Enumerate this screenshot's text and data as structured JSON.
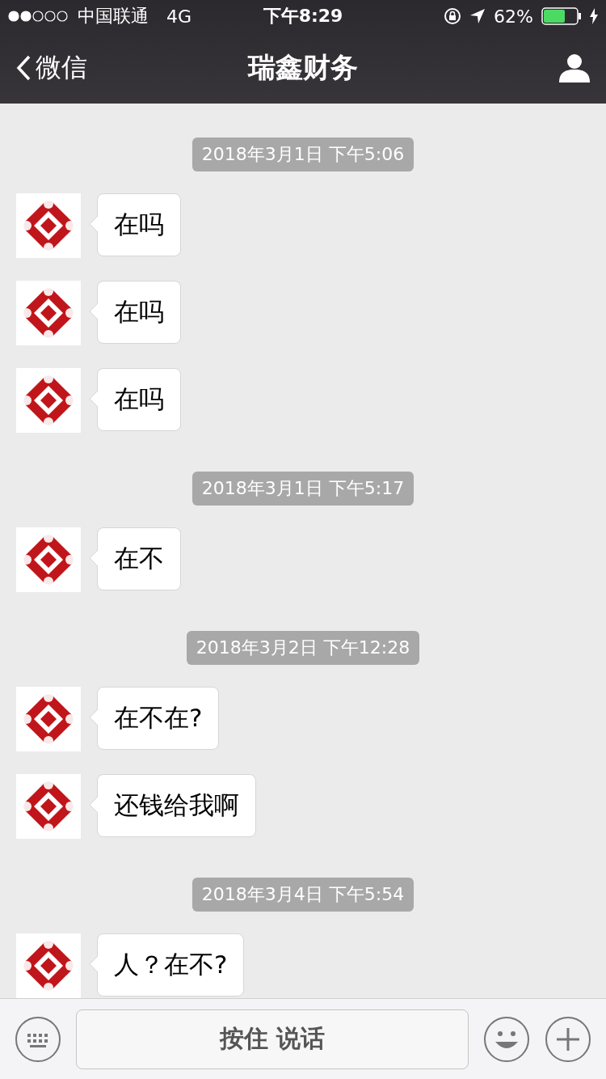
{
  "status_bar": {
    "carrier": "中国联通",
    "network": "4G",
    "time": "下午8:29",
    "battery": "62%"
  },
  "nav": {
    "back": "微信",
    "title": "瑞鑫财务"
  },
  "messages": [
    {
      "kind": "time",
      "text": "2018年3月1日 下午5:06"
    },
    {
      "kind": "incoming",
      "text": "在吗"
    },
    {
      "kind": "incoming",
      "text": "在吗"
    },
    {
      "kind": "incoming",
      "text": "在吗"
    },
    {
      "kind": "time",
      "text": "2018年3月1日 下午5:17"
    },
    {
      "kind": "incoming",
      "text": "在不"
    },
    {
      "kind": "time",
      "text": "2018年3月2日 下午12:28"
    },
    {
      "kind": "incoming",
      "text": "在不在?"
    },
    {
      "kind": "incoming",
      "text": "还钱给我啊"
    },
    {
      "kind": "time",
      "text": "2018年3月4日 下午5:54"
    },
    {
      "kind": "incoming",
      "text": "人？在不?"
    }
  ],
  "input_bar": {
    "hold_to_talk": "按住 说话"
  }
}
